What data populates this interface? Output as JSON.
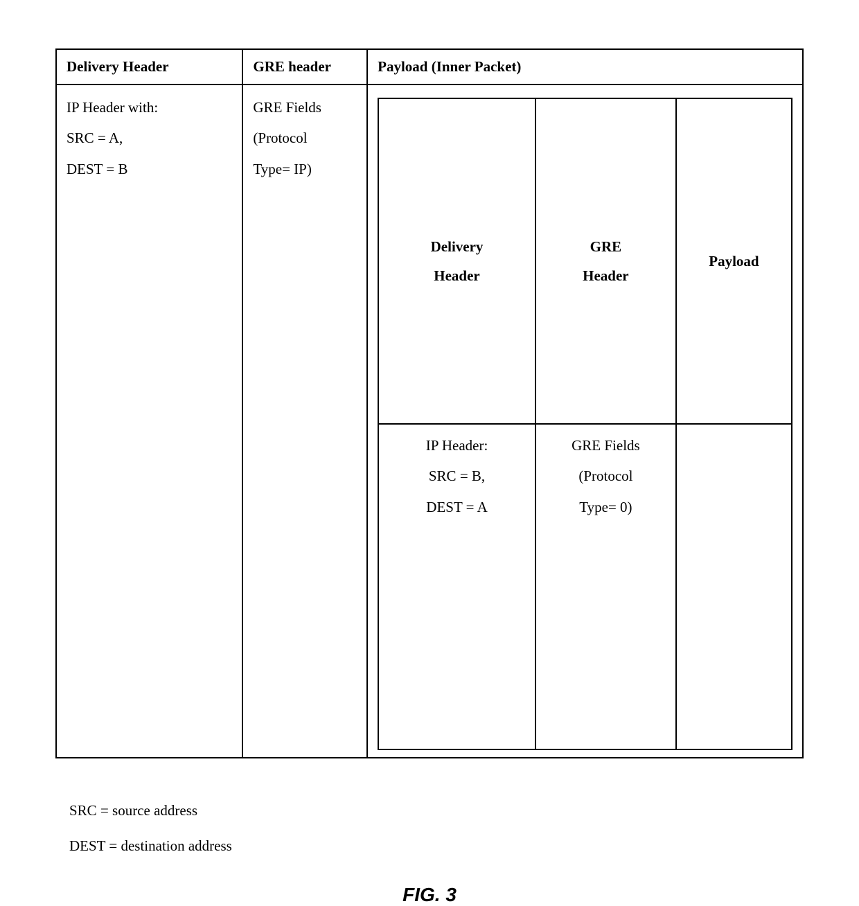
{
  "outer": {
    "headers": {
      "delivery": "Delivery Header",
      "gre": "GRE header",
      "payload": "Payload (Inner Packet)"
    },
    "delivery_lines": {
      "l1": "IP Header with:",
      "l2": "SRC = A,",
      "l3": "DEST = B"
    },
    "gre_lines": {
      "l1": "GRE Fields",
      "l2": "(Protocol",
      "l3": "Type= IP)"
    }
  },
  "inner": {
    "headers": {
      "delivery_l1": "Delivery",
      "delivery_l2": "Header",
      "gre_l1": "GRE",
      "gre_l2": "Header",
      "payload": "Payload"
    },
    "delivery_lines": {
      "l1": "IP Header:",
      "l2": "SRC = B,",
      "l3": "DEST = A"
    },
    "gre_lines": {
      "l1": "GRE Fields",
      "l2": "(Protocol",
      "l3": "Type= 0)"
    }
  },
  "legend": {
    "src": "SRC = source address",
    "dest": "DEST = destination address"
  },
  "figure_label": "FIG. 3"
}
